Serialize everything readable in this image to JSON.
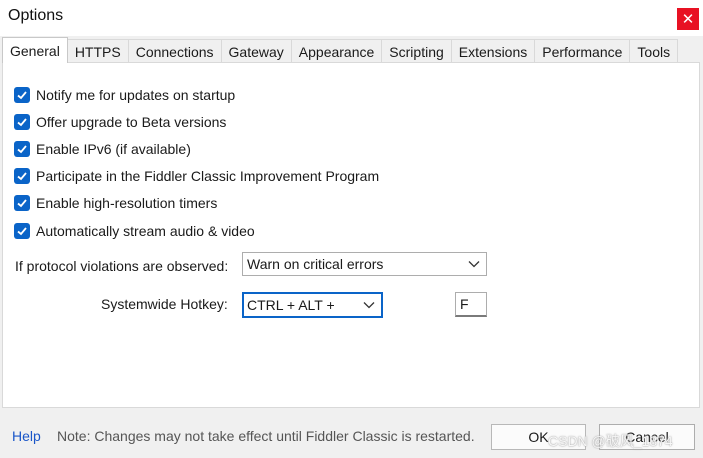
{
  "window": {
    "title": "Options",
    "close_glyph": "✕"
  },
  "tabs": [
    {
      "label": "General",
      "active": true
    },
    {
      "label": "HTTPS"
    },
    {
      "label": "Connections"
    },
    {
      "label": "Gateway"
    },
    {
      "label": "Appearance"
    },
    {
      "label": "Scripting"
    },
    {
      "label": "Extensions"
    },
    {
      "label": "Performance"
    },
    {
      "label": "Tools"
    }
  ],
  "checkboxes": [
    {
      "label": "Notify me for updates on startup",
      "checked": true
    },
    {
      "label": "Offer upgrade to Beta versions",
      "checked": true
    },
    {
      "label": "Enable IPv6 (if available)",
      "checked": true
    },
    {
      "label": "Participate in the Fiddler Classic Improvement Program",
      "checked": true
    },
    {
      "label": "Enable high-resolution timers",
      "checked": true
    },
    {
      "label": "Automatically stream audio & video",
      "checked": true
    }
  ],
  "protocol": {
    "label": "If protocol violations are observed:",
    "value": "Warn on critical errors"
  },
  "hotkey": {
    "label": "Systemwide Hotkey:",
    "modifier": "CTRL + ALT +",
    "key": "F"
  },
  "footer": {
    "help": "Help",
    "note": "Note: Changes may not take effect until Fiddler Classic is restarted.",
    "ok": "OK",
    "cancel": "Cancel"
  },
  "watermark": "CSDN @破风_1874",
  "colors": {
    "accent": "#0a64c8",
    "close": "#e81123",
    "link": "#1a56c8"
  }
}
